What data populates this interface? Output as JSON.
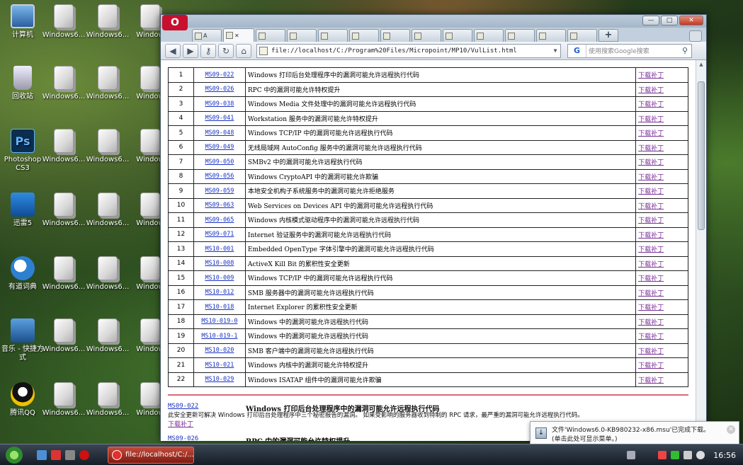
{
  "desktop": {
    "icons_left": [
      {
        "label": "计算机",
        "name": "computer"
      },
      {
        "label": "回收站",
        "name": "recycle"
      },
      {
        "label": "Photoshop CS3",
        "name": "ps"
      },
      {
        "label": "迅雷5",
        "name": "xunlei"
      },
      {
        "label": "有道词典",
        "name": "youdao"
      },
      {
        "label": "音乐 - 快捷方式",
        "name": "music"
      },
      {
        "label": "腾讯QQ",
        "name": "qq"
      }
    ],
    "file_label_a": "Windows6...",
    "file_label_b": "Windows6...",
    "file_label_c": "Window"
  },
  "browser": {
    "logo": "O",
    "tab_active_label": "",
    "first_tab_label": "A",
    "url": "file://localhost/C:/Program%20Files/Micropoint/MP10/VulList.html",
    "search_placeholder": "使用搜索Google搜索",
    "search_engine": "G",
    "table": {
      "rows": [
        {
          "num": "1",
          "id": "MS09-022",
          "title": "Windows 打印后台处理程序中的漏洞可能允许远程执行代码",
          "action": "下载补丁"
        },
        {
          "num": "2",
          "id": "MS09-026",
          "title": "RPC 中的漏洞可能允许特权提升",
          "action": "下载补丁"
        },
        {
          "num": "3",
          "id": "MS09-038",
          "title": "Windows Media 文件处理中的漏洞可能允许远程执行代码",
          "action": "下载补丁"
        },
        {
          "num": "4",
          "id": "MS09-041",
          "title": "Workstation 服务中的漏洞可能允许特权提升",
          "action": "下载补丁"
        },
        {
          "num": "5",
          "id": "MS09-048",
          "title": "Windows TCP/IP 中的漏洞可能允许远程执行代码",
          "action": "下载补丁"
        },
        {
          "num": "6",
          "id": "MS09-049",
          "title": "无线局域网 AutoConfig 服务中的漏洞可能允许远程执行代码",
          "action": "下载补丁"
        },
        {
          "num": "7",
          "id": "MS09-050",
          "title": "SMBv2 中的漏洞可能允许远程执行代码",
          "action": "下载补丁"
        },
        {
          "num": "8",
          "id": "MS09-056",
          "title": "Windows CryptoAPI 中的漏洞可能允许欺骗",
          "action": "下载补丁"
        },
        {
          "num": "9",
          "id": "MS09-059",
          "title": "本地安全机构子系统服务中的漏洞可能允许拒绝服务",
          "action": "下载补丁"
        },
        {
          "num": "10",
          "id": "MS09-063",
          "title": "Web Services on Devices API 中的漏洞可能允许远程执行代码",
          "action": "下载补丁"
        },
        {
          "num": "11",
          "id": "MS09-065",
          "title": "Windows 内核模式驱动程序中的漏洞可能允许远程执行代码",
          "action": "下载补丁"
        },
        {
          "num": "12",
          "id": "MS09-071",
          "title": "Internet 验证服务中的漏洞可能允许远程执行代码",
          "action": "下载补丁"
        },
        {
          "num": "13",
          "id": "MS10-001",
          "title": "Embedded OpenType 字体引擎中的漏洞可能允许远程执行代码",
          "action": "下载补丁"
        },
        {
          "num": "14",
          "id": "MS10-008",
          "title": "ActiveX Kill Bit 的累积性安全更新",
          "action": "下载补丁"
        },
        {
          "num": "15",
          "id": "MS10-009",
          "title": "Windows TCP/IP 中的漏洞可能允许远程执行代码",
          "action": "下载补丁"
        },
        {
          "num": "16",
          "id": "MS10-012",
          "title": "SMB 服务器中的漏洞可能允许远程执行代码",
          "action": "下载补丁"
        },
        {
          "num": "17",
          "id": "MS10-018",
          "title": "Internet Explorer 的累积性安全更新",
          "action": "下载补丁"
        },
        {
          "num": "18",
          "id": "MS10-019-0",
          "title": "Windows 中的漏洞可能允许远程执行代码",
          "action": "下载补丁"
        },
        {
          "num": "19",
          "id": "MS10-019-1",
          "title": "Windows 中的漏洞可能允许远程执行代码",
          "action": "下载补丁"
        },
        {
          "num": "20",
          "id": "MS10-020",
          "title": "SMB 客户端中的漏洞可能允许远程执行代码",
          "action": "下载补丁"
        },
        {
          "num": "21",
          "id": "MS10-021",
          "title": "Windows 内核中的漏洞可能允许特权提升",
          "action": "下载补丁"
        },
        {
          "num": "22",
          "id": "MS10-029",
          "title": "Windows ISATAP 组件中的漏洞可能允许欺骗",
          "action": "下载补丁"
        }
      ]
    },
    "detail": {
      "id": "MS09-022",
      "title": "Windows 打印后台处理程序中的漏洞可能允许远程执行代码",
      "desc": "此安全更新可解决 Windows 打印后台处理程序中三个秘密报告的漏洞。 如果受影响的服务器收到特制的 RPC 请求，最严重的漏洞可能允许远程执行代码。",
      "action": "下载补丁",
      "next_id": "MS09-026",
      "next_title": "RPC 中的漏洞可能允许特权提升"
    }
  },
  "notification": {
    "line1": "文件'Windows6.0-KB980232-x86.msu'已完成下载。",
    "line2": "(单击此处可显示菜单。)"
  },
  "taskbar": {
    "task_label": "file://localhost/C:/...",
    "clock": "16:56"
  },
  "colors": {
    "link": "#1b34c2",
    "visited_link": "#7b2f9a",
    "separator": "#d86b7a",
    "opera_red": "#c8102e"
  }
}
